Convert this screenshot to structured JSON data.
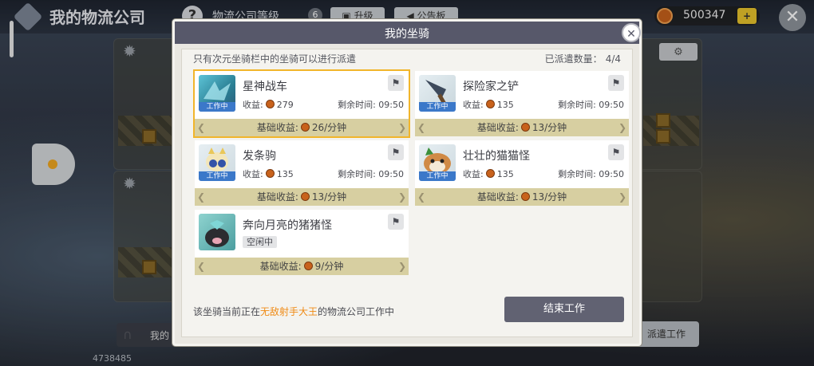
{
  "background": {
    "title": "我的物流公司",
    "level_label": "物流公司等级",
    "level_value": "6",
    "upgrade_label": "升级",
    "board_label": "公告板",
    "coins": "500347",
    "coin_add_label": "+",
    "bottom_left_label": "我的",
    "bottom_number": "4738485",
    "bottom_right_label": "派遣工作"
  },
  "modal": {
    "title": "我的坐骑",
    "hint": "只有次元坐骑栏中的坐骑可以进行派遣",
    "dispatched_label": "已派遣数量：",
    "dispatched_count": "4/4",
    "cards": [
      {
        "name": "星神战车",
        "income_label": "收益:",
        "income": "279",
        "time_label": "剩余时间:",
        "time": "09:50",
        "base": "基础收益:",
        "base_rate": "26/分钟",
        "status": "工作中",
        "portrait": "star-chariot-icon",
        "color": "#3fa2b7"
      },
      {
        "name": "探险家之铲",
        "income_label": "收益:",
        "income": "135",
        "time_label": "剩余时间:",
        "time": "09:50",
        "base": "基础收益:",
        "base_rate": "13/分钟",
        "status": "工作中",
        "portrait": "shovel-icon",
        "color": "#4a6b8a"
      },
      {
        "name": "发条驹",
        "income_label": "收益:",
        "income": "135",
        "time_label": "剩余时间:",
        "time": "09:50",
        "base": "基础收益:",
        "base_rate": "13/分钟",
        "status": "工作中",
        "portrait": "clockwork-horse-icon",
        "color": "#e9d89a"
      },
      {
        "name": "壮壮的猫猫怪",
        "income_label": "收益:",
        "income": "135",
        "time_label": "剩余时间:",
        "time": "09:50",
        "base": "基础收益:",
        "base_rate": "13/分钟",
        "status": "工作中",
        "portrait": "cat-monster-icon",
        "color": "#c7853e"
      },
      {
        "name": "奔向月亮的猪猪怪",
        "status": "空闲中",
        "base": "基础收益:",
        "base_rate": "9/分钟",
        "portrait": "pig-monster-icon",
        "color": "#6ec0c0"
      }
    ],
    "footer_prefix": "该坐骑当前正在",
    "footer_name": "无敌射手大王",
    "footer_suffix": "的物流公司工作中",
    "end_button": "结束工作"
  },
  "colors": {
    "header": "#57586a",
    "selected_border": "#f1b52b",
    "base_bar": "#d7cfa1",
    "status_tag": "#3b78c9",
    "highlight": "#ef8a14"
  }
}
